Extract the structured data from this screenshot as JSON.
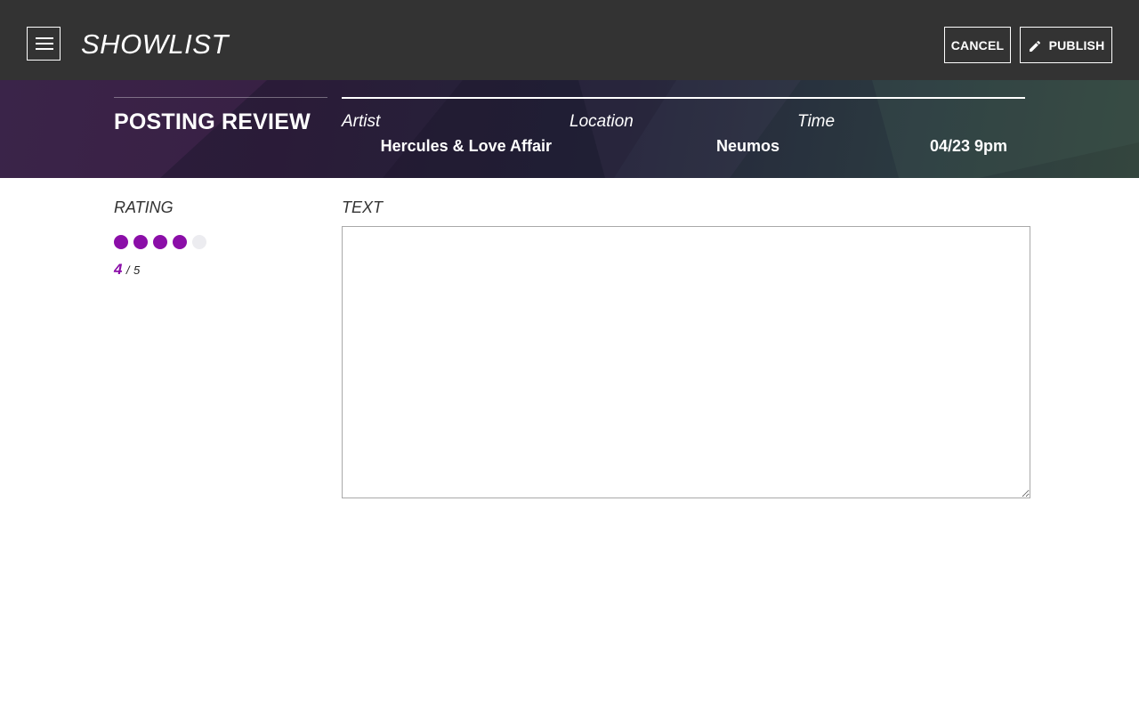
{
  "app": {
    "title": "SHOWLIST"
  },
  "toolbar": {
    "cancel_label": "CANCEL",
    "publish_label": "PUBLISH"
  },
  "hero": {
    "heading": "POSTING REVIEW",
    "fields": [
      {
        "label": "Artist",
        "value": "Hercules & Love Affair"
      },
      {
        "label": "Location",
        "value": "Neumos"
      },
      {
        "label": "Time",
        "value": "04/23 9pm"
      }
    ]
  },
  "rating": {
    "label": "RATING",
    "value": "4",
    "max": "5",
    "separator": "/"
  },
  "review": {
    "label": "TEXT",
    "text": "",
    "placeholder": ""
  },
  "colors": {
    "topbar": "#333333",
    "accent": "#8b0ea8",
    "dot_empty": "#ececf0"
  },
  "icons": {
    "menu": "menu-icon",
    "publish": "pencil-icon"
  }
}
